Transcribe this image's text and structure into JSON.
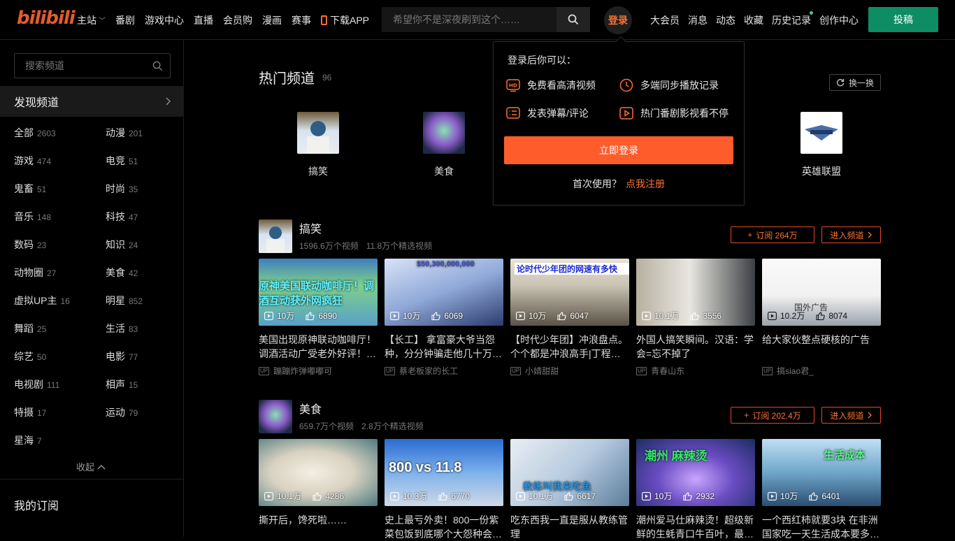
{
  "header": {
    "logo": "bilibili",
    "nav": [
      "主站",
      "番剧",
      "游戏中心",
      "直播",
      "会员购",
      "漫画",
      "赛事"
    ],
    "download_app": "下载APP",
    "search_placeholder": "希望你不是深夜刷到这个……",
    "login": "登录",
    "right_nav": [
      "大会员",
      "消息",
      "动态",
      "收藏",
      "历史记录",
      "创作中心"
    ],
    "post_button": "投稿"
  },
  "sidebar": {
    "search_placeholder": "搜索频道",
    "discover": "发现频道",
    "categories": [
      {
        "name": "全部",
        "count": "2603"
      },
      {
        "name": "动漫",
        "count": "201"
      },
      {
        "name": "游戏",
        "count": "474"
      },
      {
        "name": "电竞",
        "count": "51"
      },
      {
        "name": "鬼畜",
        "count": "51"
      },
      {
        "name": "时尚",
        "count": "35"
      },
      {
        "name": "音乐",
        "count": "148"
      },
      {
        "name": "科技",
        "count": "47"
      },
      {
        "name": "数码",
        "count": "23"
      },
      {
        "name": "知识",
        "count": "24"
      },
      {
        "name": "动物圈",
        "count": "27"
      },
      {
        "name": "美食",
        "count": "42"
      },
      {
        "name": "虚拟UP主",
        "count": "16"
      },
      {
        "name": "明星",
        "count": "852"
      },
      {
        "name": "舞蹈",
        "count": "25"
      },
      {
        "name": "生活",
        "count": "83"
      },
      {
        "name": "综艺",
        "count": "50"
      },
      {
        "name": "电影",
        "count": "77"
      },
      {
        "name": "电视剧",
        "count": "111"
      },
      {
        "name": "相声",
        "count": "15"
      },
      {
        "name": "特摄",
        "count": "17"
      },
      {
        "name": "运动",
        "count": "79"
      },
      {
        "name": "星海",
        "count": "7"
      }
    ],
    "collapse": "收起",
    "my_subscriptions": "我的订阅"
  },
  "hot": {
    "title": "热门频道",
    "count": "96",
    "refresh": "换一换",
    "channels": [
      "搞笑",
      "美食",
      "英雄联盟"
    ]
  },
  "sections": [
    {
      "name": "搞笑",
      "videos_count": "1596.6万个视频",
      "featured_count": "11.8万个精选视频",
      "subscribe": "订阅 264万",
      "enter": "进入频道",
      "cards": [
        {
          "views": "10万",
          "likes": "6890",
          "title": "美国出现原神联动咖啡厅！调酒活动广受老外好评！…",
          "up": "蹦蹦炸弹嘟嘟可",
          "overlay": "原神美国联动咖啡厅！调酒互动获外网疯狂"
        },
        {
          "views": "10万",
          "likes": "6069",
          "title": "【长工】 拿富豪大爷当怨种，分分钟骗走他几十万…",
          "up": "蔡老板家的长工",
          "overlay": "$50,300,000,000"
        },
        {
          "views": "10万",
          "likes": "6047",
          "title": "【时代少年团】冲浪盘点。个个都是冲浪高手|丁程…",
          "up": "小婧甜甜",
          "overlay": "论时代少年团的网速有多快"
        },
        {
          "views": "10.1万",
          "likes": "3556",
          "title": "外国人搞笑瞬间。汉语：学会=忘不掉了",
          "up": "青春山东",
          "overlay": ""
        },
        {
          "views": "10.2万",
          "likes": "8074",
          "title": "给大家伙整点硬核的广告",
          "up": "搞siao君_",
          "overlay": "国外广告"
        }
      ]
    },
    {
      "name": "美食",
      "videos_count": "659.7万个视频",
      "featured_count": "2.8万个精选视频",
      "subscribe": "订阅 202.4万",
      "enter": "进入频道",
      "cards": [
        {
          "views": "10.1万",
          "likes": "4286",
          "title": "撕开后，馋死啦……",
          "up": "",
          "overlay": ""
        },
        {
          "views": "10.3万",
          "likes": "6770",
          "title": "史上最亏外卖！800一份紫菜包饭到底哪个大怨种会…",
          "up": "",
          "overlay": "800 vs 11.8"
        },
        {
          "views": "10.1万",
          "likes": "6617",
          "title": "吃东西我一直是服从教练管理",
          "up": "",
          "overlay": "教练叫我来吃鱼"
        },
        {
          "views": "10万",
          "likes": "2932",
          "title": "潮州爱马仕麻辣烫！超级新鲜的生蚝青口牛百叶，最…",
          "up": "",
          "overlay": "潮州 麻辣烫"
        },
        {
          "views": "10万",
          "likes": "6401",
          "title": "一个西红柿就要3块 在非洲国家吃一天生活成本要多…",
          "up": "",
          "overlay": "生活成本"
        }
      ]
    }
  ],
  "login_popup": {
    "heading": "登录后你可以：",
    "features": [
      "免费看高清视频",
      "多端同步播放记录",
      "发表弹幕/评论",
      "热门番剧影视看不停"
    ],
    "login_button": "立即登录",
    "first_time": "首次使用？",
    "register": "点我注册"
  },
  "colors": {
    "accent": "#fb7233",
    "post": "#0e8c63",
    "login_btn": "#ff5c2c"
  }
}
